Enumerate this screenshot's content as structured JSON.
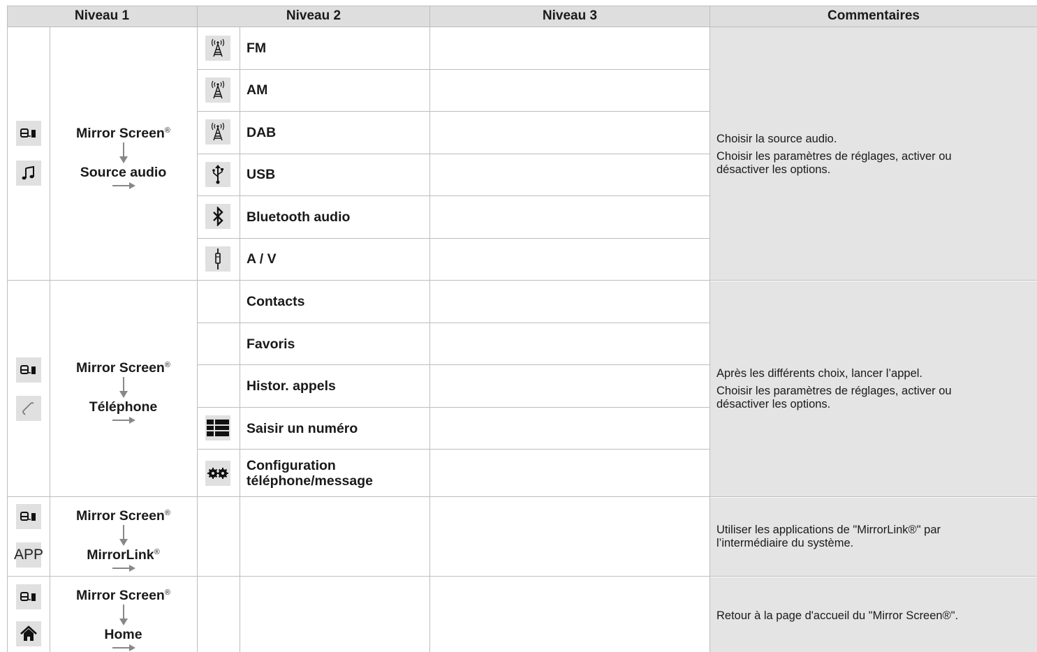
{
  "header": {
    "col1": "Niveau 1",
    "col2": "Niveau 2",
    "col3": "Niveau 3",
    "col4": "Commentaires"
  },
  "sections": [
    {
      "level1_line1": "Mirror Screen",
      "level1_line2": "Source audio",
      "icons": [
        "mirror-screen-icon",
        "music-note-icon"
      ],
      "items": [
        {
          "label": "FM",
          "icon": "antenna-icon"
        },
        {
          "label": "AM",
          "icon": "antenna-icon"
        },
        {
          "label": "DAB",
          "icon": "antenna-icon"
        },
        {
          "label": "USB",
          "icon": "usb-icon"
        },
        {
          "label": "Bluetooth audio",
          "icon": "bluetooth-icon"
        },
        {
          "label": "A / V",
          "icon": "jack-icon"
        }
      ],
      "comment": [
        "Choisir la source audio.",
        "Choisir les paramètres de réglages, activer ou désactiver les options."
      ]
    },
    {
      "level1_line1": "Mirror Screen",
      "level1_line2": "Téléphone",
      "icons": [
        "mirror-screen-icon",
        "phone-handset-icon"
      ],
      "items": [
        {
          "label": "Contacts",
          "icon": ""
        },
        {
          "label": "Favoris",
          "icon": ""
        },
        {
          "label": "Histor. appels",
          "icon": ""
        },
        {
          "label": "Saisir un numéro",
          "icon": "keypad-icon"
        },
        {
          "label": "Configuration",
          "label2": "téléphone/message",
          "icon": "gears-icon"
        }
      ],
      "comment": [
        "Après les différents choix, lancer l’appel.",
        "Choisir les paramètres de réglages, activer ou désactiver les options."
      ]
    },
    {
      "level1_line1": "Mirror Screen",
      "level1_line2": "MirrorLink",
      "icons": [
        "mirror-screen-icon",
        "app-icon"
      ],
      "app_label": "APP",
      "comment": [
        "Utiliser les applications de \"MirrorLink®\" par l’intermédiaire du système."
      ]
    },
    {
      "level1_line1": "Mirror Screen",
      "level1_line2": "Home",
      "icons": [
        "mirror-screen-icon",
        "home-icon"
      ],
      "comment": [
        "Retour à la page d'accueil du \"Mirror Screen®\"."
      ]
    }
  ],
  "registered_mark": "®"
}
